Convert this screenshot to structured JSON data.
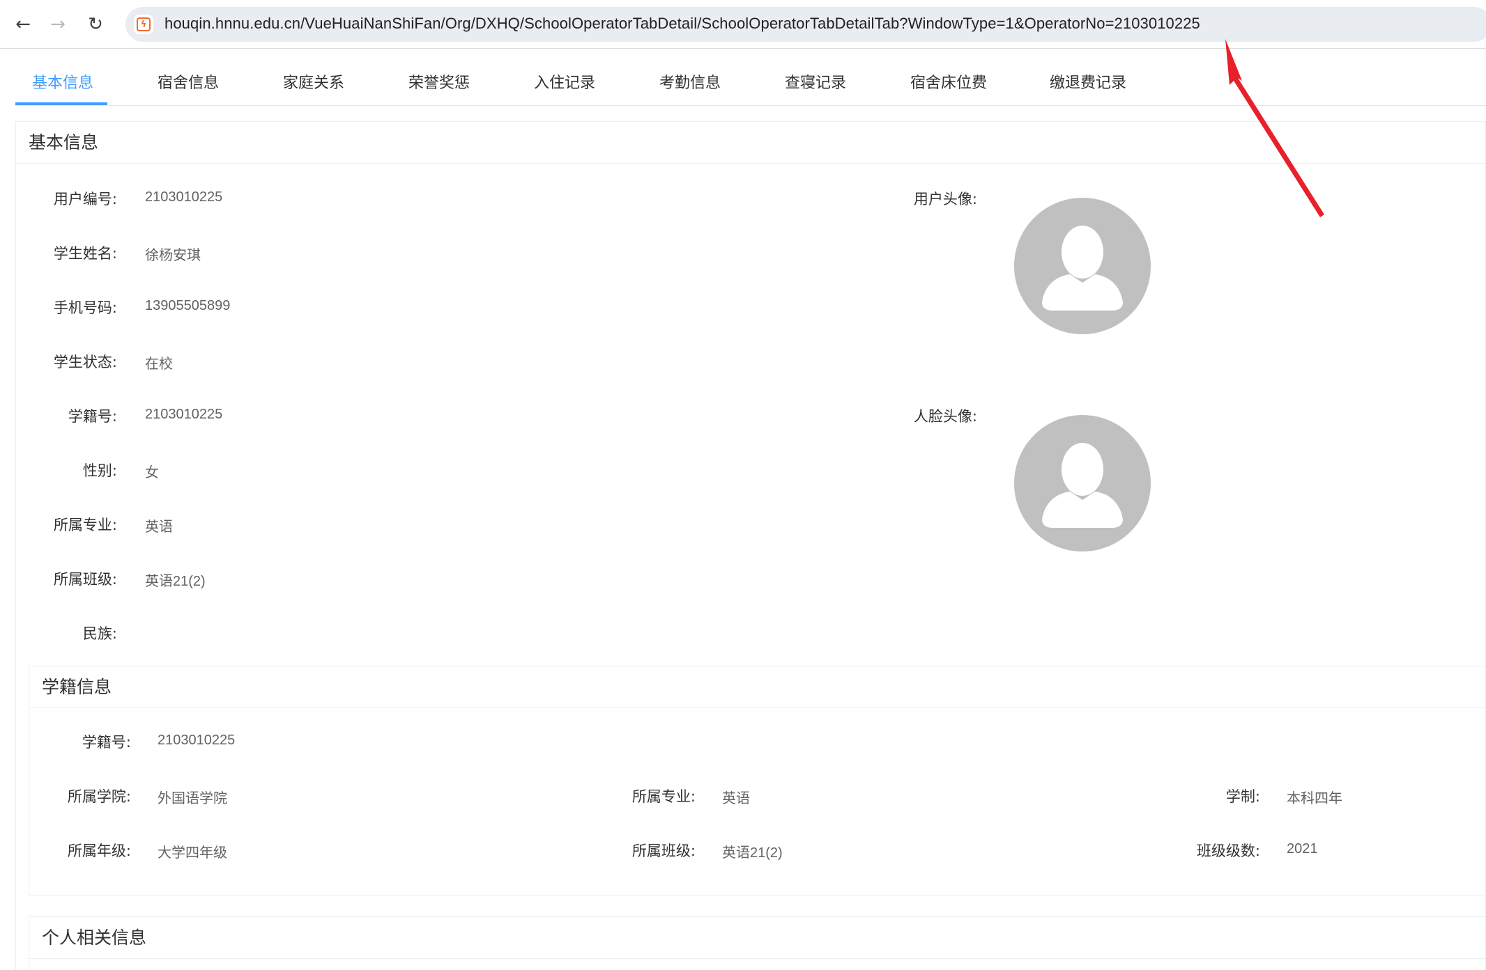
{
  "browser": {
    "back_icon": "←",
    "forward_icon": "→",
    "reload_icon": "↻",
    "site_icon_glyph": "ϟ",
    "url": "houqin.hnnu.edu.cn/VueHuaiNanShiFan/Org/DXHQ/SchoolOperatorTabDetail/SchoolOperatorTabDetailTab?WindowType=1&OperatorNo=2103010225"
  },
  "tabs": [
    {
      "label": "基本信息",
      "active": true
    },
    {
      "label": "宿舍信息"
    },
    {
      "label": "家庭关系"
    },
    {
      "label": "荣誉奖惩"
    },
    {
      "label": "入住记录"
    },
    {
      "label": "考勤信息"
    },
    {
      "label": "查寝记录"
    },
    {
      "label": "宿舍床位费"
    },
    {
      "label": "缴退费记录"
    }
  ],
  "basic": {
    "title": "基本信息",
    "fields": {
      "user_no": {
        "label": "用户编号:",
        "value": "2103010225"
      },
      "name": {
        "label": "学生姓名:",
        "value": "徐杨安琪"
      },
      "phone": {
        "label": "手机号码:",
        "value": "13905505899"
      },
      "status": {
        "label": "学生状态:",
        "value": "在校"
      },
      "student_no": {
        "label": "学籍号:",
        "value": "2103010225"
      },
      "gender": {
        "label": "性别:",
        "value": "女"
      },
      "major": {
        "label": "所属专业:",
        "value": "英语"
      },
      "class": {
        "label": "所属班级:",
        "value": "英语21(2)"
      },
      "ethnicity": {
        "label": "民族:",
        "value": ""
      }
    },
    "user_avatar_label": "用户头像:",
    "face_avatar_label": "人脸头像:"
  },
  "enrollment": {
    "title": "学籍信息",
    "student_no": {
      "label": "学籍号:",
      "value": "2103010225"
    },
    "college": {
      "label": "所属学院:",
      "value": "外国语学院"
    },
    "major": {
      "label": "所属专业:",
      "value": "英语"
    },
    "duration": {
      "label": "学制:",
      "value": "本科四年"
    },
    "grade": {
      "label": "所属年级:",
      "value": "大学四年级"
    },
    "class": {
      "label": "所属班级:",
      "value": "英语21(2)"
    },
    "cohort": {
      "label": "班级级数:",
      "value": "2021"
    }
  },
  "personal": {
    "title": "个人相关信息"
  },
  "colors": {
    "accent": "#409eff",
    "annotation_arrow": "#e8202a",
    "avatar_bg": "#c0c0c0"
  }
}
